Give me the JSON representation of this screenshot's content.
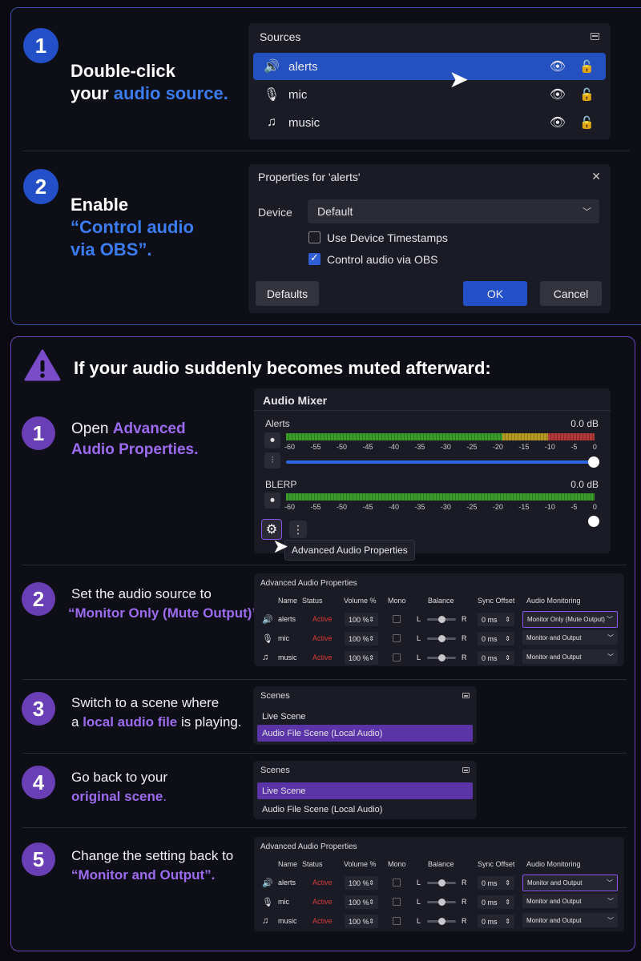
{
  "step_top": [
    {
      "num": "1",
      "line1": "Double-click",
      "line2a": "your ",
      "line2b": "audio source."
    },
    {
      "num": "2",
      "line1": "Enable",
      "line2": "“Control audio",
      "line3": "via OBS”."
    }
  ],
  "sources": {
    "title": "Sources",
    "items": [
      {
        "label": "alerts",
        "icon": "🔊"
      },
      {
        "label": "mic",
        "icon": "🎙"
      },
      {
        "label": "music",
        "icon": "♫"
      }
    ]
  },
  "properties": {
    "title": "Properties for 'alerts'",
    "close": "✕",
    "device_label": "Device",
    "device_value": "Default",
    "opt1": "Use Device Timestamps",
    "opt2": "Control audio via OBS",
    "defaults": "Defaults",
    "ok": "OK",
    "cancel": "Cancel"
  },
  "warning": {
    "title": "If your audio suddenly becomes muted afterward:"
  },
  "steps": [
    {
      "num": "1",
      "a": "Open ",
      "b": "Advanced",
      "c": "Audio Properties."
    },
    {
      "num": "2",
      "a": "Set the audio source to",
      "b": "“Monitor Only (Mute Output)”."
    },
    {
      "num": "3",
      "a": "Switch to a scene where",
      "b1": "a ",
      "b2": "local audio file",
      "b3": " is playing."
    },
    {
      "num": "4",
      "a": "Go back to your",
      "b": "original scene",
      "c": "."
    },
    {
      "num": "5",
      "a": "Change the setting back to",
      "b": "“Monitor and Output”."
    }
  ],
  "mixer": {
    "title": "Audio Mixer",
    "ch1": "Alerts",
    "ch2": "BLERP",
    "db": "0.0 dB",
    "ticks": [
      "-60",
      "-55",
      "-50",
      "-45",
      "-40",
      "-35",
      "-30",
      "-25",
      "-20",
      "-15",
      "-10",
      "-5",
      "0"
    ],
    "tooltip": "Advanced Audio Properties"
  },
  "aap": {
    "title": "Advanced Audio Properties",
    "headers": [
      "Name",
      "Status",
      "Volume %",
      "Mono",
      "Balance",
      "Sync Offset",
      "Audio Monitoring"
    ],
    "rows": [
      {
        "name": "alerts",
        "icon": "🔊",
        "status": "Active",
        "vol": "100 %",
        "L": "L",
        "R": "R",
        "sync": "0 ms"
      },
      {
        "name": "mic",
        "icon": "🎙",
        "status": "Active",
        "vol": "100 %",
        "L": "L",
        "R": "R",
        "sync": "0 ms"
      },
      {
        "name": "music",
        "icon": "♫",
        "status": "Active",
        "vol": "100 %",
        "L": "L",
        "R": "R",
        "sync": "0 ms"
      }
    ],
    "mon1": [
      "Monitor Only (Mute Output)",
      "Monitor and Output",
      "Monitor and Output"
    ],
    "mon2": [
      "Monitor and Output",
      "Monitor and Output",
      "Monitor and Output"
    ]
  },
  "scenes": {
    "title": "Scenes",
    "items": [
      "Live Scene",
      "Audio File Scene (Local Audio)"
    ]
  }
}
